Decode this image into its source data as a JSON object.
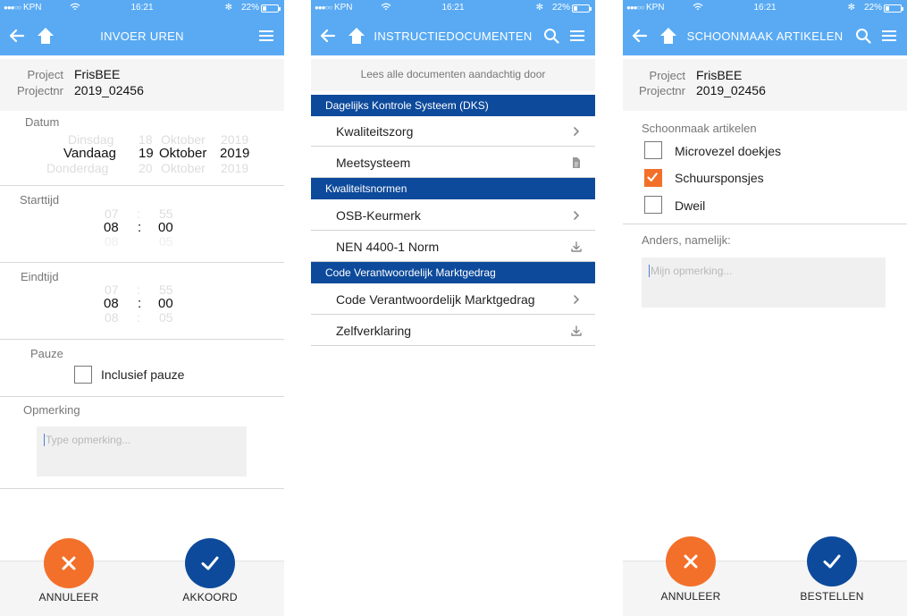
{
  "status": {
    "signal": "●●●○○",
    "carrier": "KPN",
    "time": "16:21",
    "battery": "22%",
    "battery_level": 0.22
  },
  "invoer": {
    "title": "INVOER UREN",
    "project_label": "Project",
    "projectnr_label": "Projectnr",
    "project_value": "FrisBEE",
    "projectnr_value": "2019_02456",
    "datum_label": "Datum",
    "datum": {
      "prev": {
        "day": "Dinsdag",
        "num": "18",
        "month": "Oktober",
        "year": "2019"
      },
      "sel": {
        "day": "Vandaag",
        "num": "19",
        "month": "Oktober",
        "year": "2019"
      },
      "next": {
        "day": "Donderdag",
        "num": "20",
        "month": "Oktober",
        "year": "2019"
      }
    },
    "starttijd_label": "Starttijd",
    "starttijd": {
      "prev_h": "07",
      "prev_m": "55",
      "sel_h": "08",
      "sel_m": "00",
      "next_h": "08",
      "next_m": "05",
      "sep": ":"
    },
    "eindtijd_label": "Eindtijd",
    "eindtijd": {
      "prev_h": "07",
      "prev_m": "55",
      "sel_h": "08",
      "sel_m": "00",
      "next_h": "08",
      "next_m": "05",
      "sep": ":"
    },
    "pauze_label": "Pauze",
    "pauze_checkbox_label": "Inclusief pauze",
    "pauze_checked": false,
    "opmerking_label": "Opmerking",
    "opmerking_placeholder": "Type opmerking...",
    "cancel_label": "ANNULEER",
    "confirm_label": "AKKOORD"
  },
  "instructie": {
    "title": "INSTRUCTIEDOCUMENTEN",
    "info": "Lees alle documenten aandachtig door",
    "sections": [
      {
        "header": "Dagelijks Kontrole Systeem (DKS)",
        "items": [
          {
            "label": "Kwaliteitszorg",
            "icon": "chevron-right-icon"
          },
          {
            "label": "Meetsysteem",
            "icon": "document-icon"
          }
        ]
      },
      {
        "header": "Kwaliteitsnormen",
        "items": [
          {
            "label": "OSB-Keurmerk",
            "icon": "chevron-right-icon"
          },
          {
            "label": "NEN 4400-1 Norm",
            "icon": "download-icon"
          }
        ]
      },
      {
        "header": "Code Verantwoordelijk Marktgedrag",
        "items": [
          {
            "label": "Code Verantwoordelijk Marktgedrag",
            "icon": "chevron-right-icon"
          },
          {
            "label": "Zelfverklaring",
            "icon": "download-icon"
          }
        ]
      }
    ]
  },
  "schoonmaak": {
    "title": "SCHOONMAAK ARTIKELEN",
    "project_label": "Project",
    "projectnr_label": "Projectnr",
    "project_value": "FrisBEE",
    "projectnr_value": "2019_02456",
    "section_label": "Schoonmaak artikelen",
    "items": [
      {
        "label": "Microvezel doekjes",
        "checked": false
      },
      {
        "label": "Schuursponsjes",
        "checked": true
      },
      {
        "label": "Dweil",
        "checked": false
      }
    ],
    "anders_label": "Anders, namelijk:",
    "opmerking_placeholder": "Mijn opmerking...",
    "cancel_label": "ANNULEER",
    "confirm_label": "BESTELLEN"
  },
  "colors": {
    "topbar": "#59aaf3",
    "section_header": "#0d4a9b",
    "accent_orange": "#f3702a",
    "accent_blue": "#0d4a9b"
  }
}
